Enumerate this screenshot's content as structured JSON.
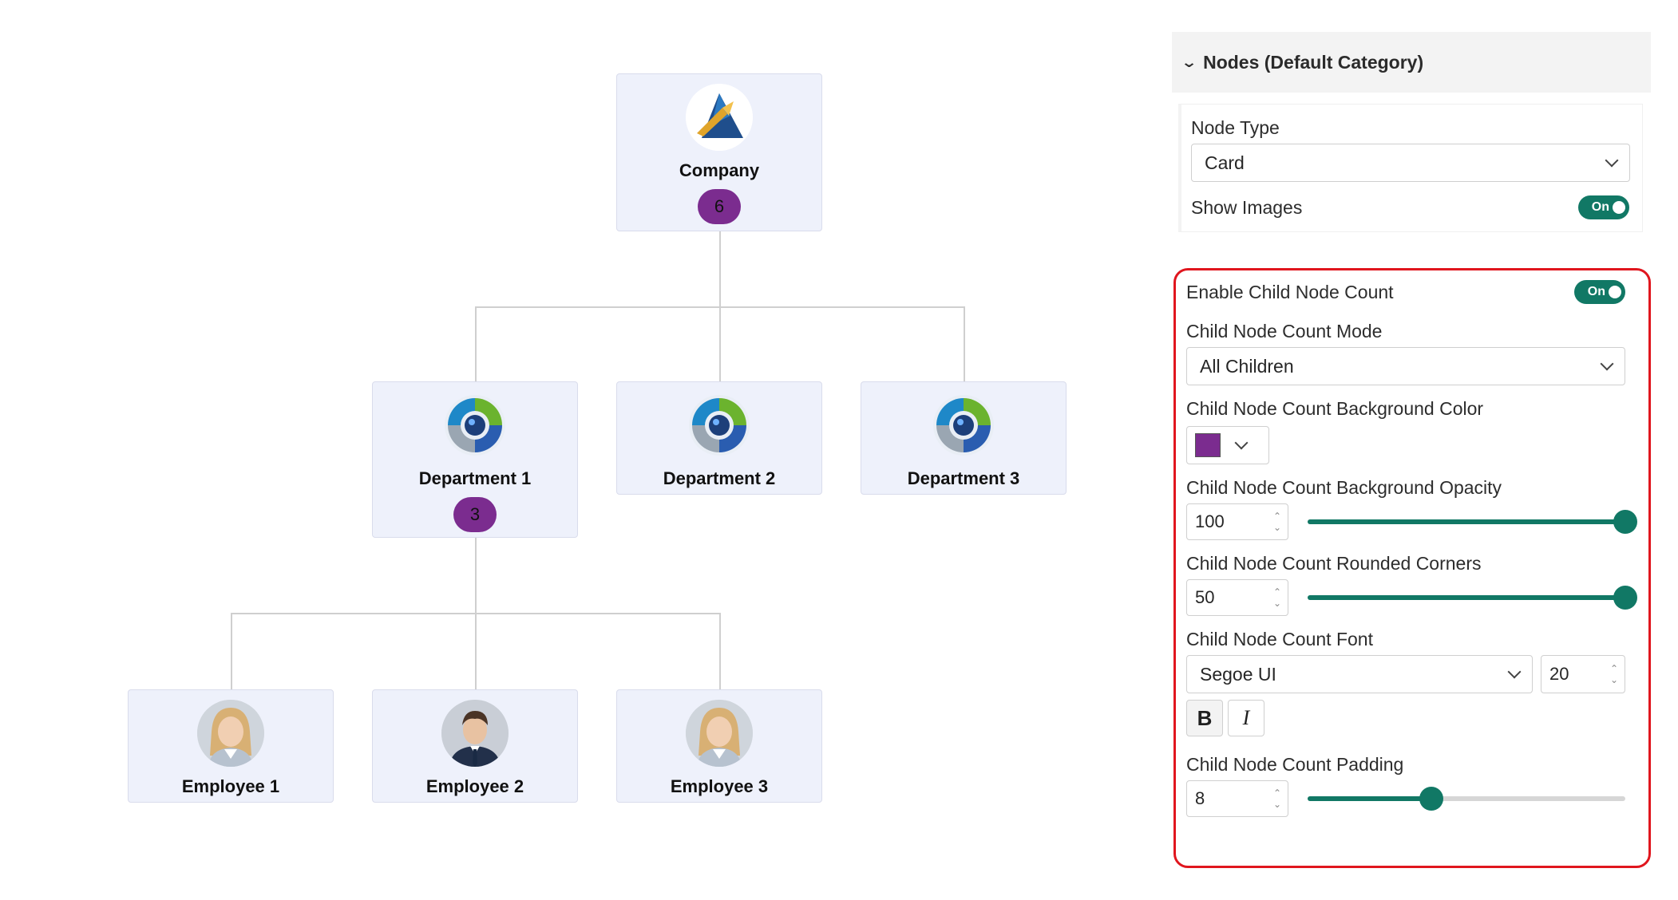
{
  "chart": {
    "company": {
      "name": "Company",
      "count": "6"
    },
    "departments": [
      {
        "name": "Department 1",
        "count": "3"
      },
      {
        "name": "Department 2"
      },
      {
        "name": "Department 3"
      }
    ],
    "employees": [
      {
        "name": "Employee 1"
      },
      {
        "name": "Employee 2"
      },
      {
        "name": "Employee 3"
      }
    ],
    "badge_color": "#7b2c8f"
  },
  "panel": {
    "section_title": "Nodes (Default Category)",
    "node_type_label": "Node Type",
    "node_type_value": "Card",
    "show_images_label": "Show Images",
    "show_images_state": "On",
    "enable_count_label": "Enable Child Node Count",
    "enable_count_state": "On",
    "count_mode_label": "Child Node Count Mode",
    "count_mode_value": "All Children",
    "bg_color_label": "Child Node Count Background Color",
    "bg_color": "#7b2c8f",
    "opacity_label": "Child Node Count Background Opacity",
    "opacity_value": "100",
    "opacity_fraction": 1.0,
    "corners_label": "Child Node Count Rounded Corners",
    "corners_value": "50",
    "corners_fraction": 1.0,
    "font_label": "Child Node Count Font",
    "font_family_value": "Segoe UI",
    "font_size_value": "20",
    "bold_label": "B",
    "italic_label": "I",
    "padding_label": "Child Node Count Padding",
    "padding_value": "8",
    "padding_fraction": 0.39,
    "accent_color": "#117865",
    "highlight_color": "#e0161e"
  }
}
